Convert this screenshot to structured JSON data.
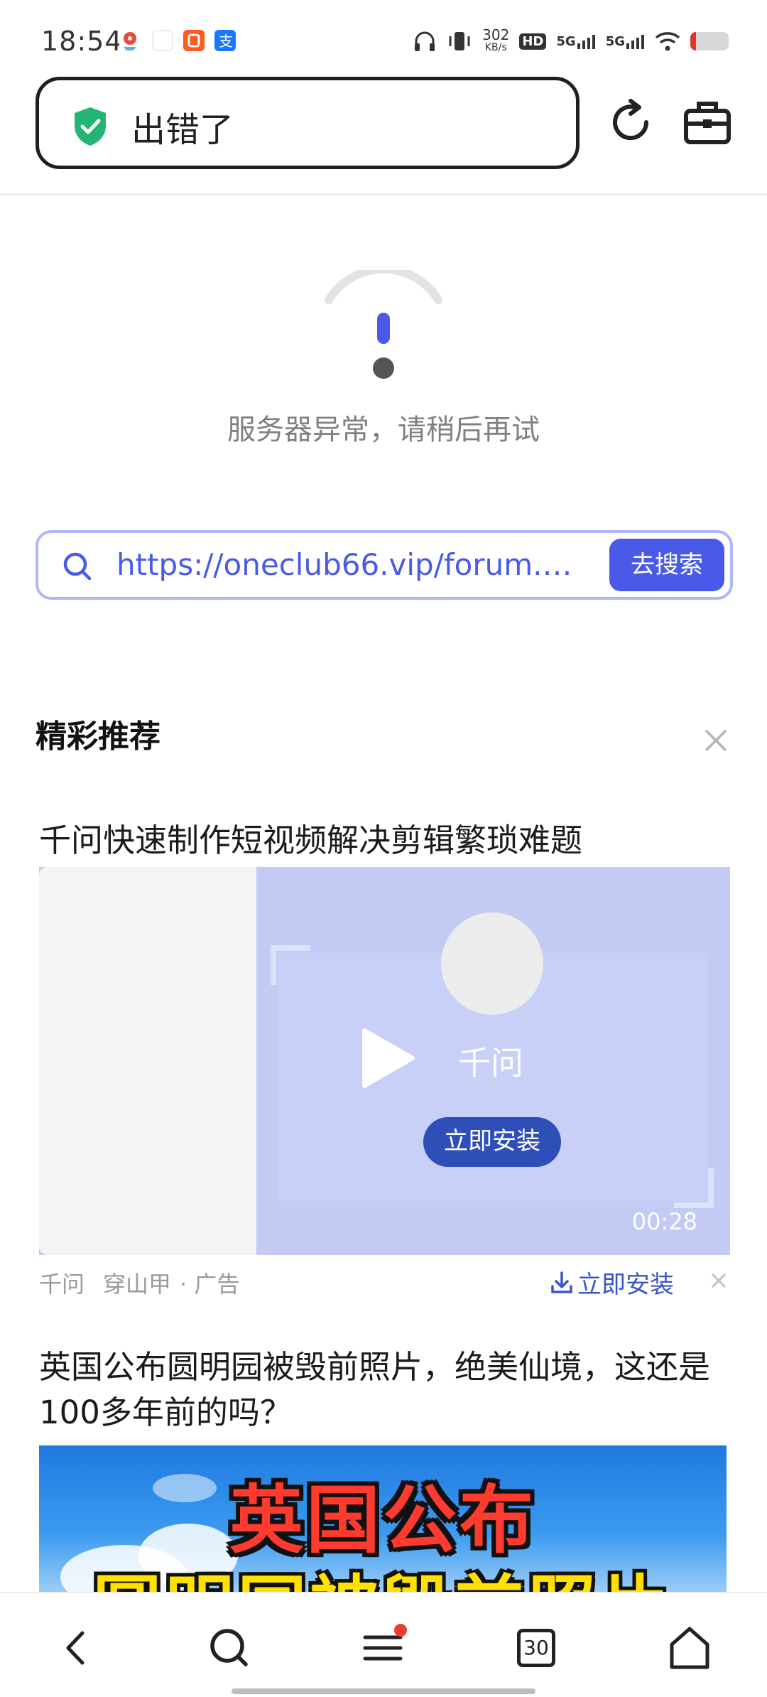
{
  "status_bar": {
    "time": "18:54",
    "net_speed": "302\nKB/s",
    "net_speed_value": "302",
    "net_speed_unit": "KB/s",
    "hd_label": "HD",
    "signal_1": "5G",
    "signal_2": "5G"
  },
  "address_bar": {
    "title": "出错了",
    "shield_icon": "shield-check-icon",
    "shield_color": "#22b573"
  },
  "error": {
    "message": "服务器异常，请稍后再试",
    "accent": "#4a5ae8"
  },
  "search": {
    "url": "https://oneclub66.vip/forum.…",
    "button_label": "去搜索"
  },
  "recommend": {
    "title": "精彩推荐"
  },
  "article1": {
    "title": "千问快速制作短视频解决剪辑繁琐难题",
    "app_name": "千问",
    "install_label": "立即安装",
    "duration": "00:28",
    "meta_source": "千问",
    "meta_tag": "穿山甲",
    "meta_ad": "· 广告",
    "meta_install": "立即安装"
  },
  "article2": {
    "title": "英国公布圆明园被毁前照片，绝美仙境，这还是100多年前的吗？",
    "image_text_line1": "英国公布",
    "image_text_line2": "圆明园被毁前照片"
  },
  "bottom_nav": {
    "tabs_count": "30",
    "has_badge": true,
    "badge_color": "#ee3b35"
  }
}
